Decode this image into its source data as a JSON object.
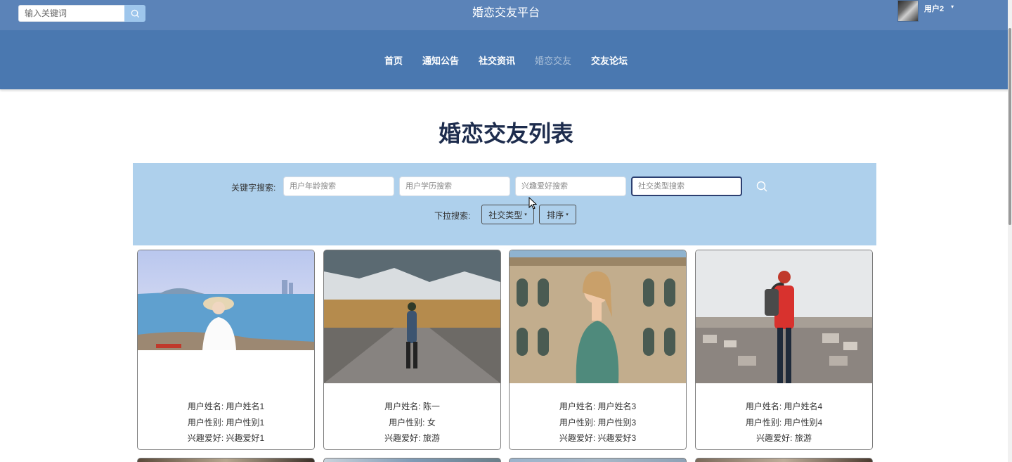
{
  "header": {
    "search_placeholder": "输入关键词",
    "site_title": "婚恋交友平台",
    "user_name": "用户2",
    "caret": "▾"
  },
  "nav": {
    "items": [
      {
        "label": "首页"
      },
      {
        "label": "通知公告"
      },
      {
        "label": "社交资讯"
      },
      {
        "label": "婚恋交友",
        "active": true
      },
      {
        "label": "交友论坛"
      }
    ]
  },
  "page": {
    "title": "婚恋交友列表"
  },
  "search_panel": {
    "keyword_label": "关键字搜索:",
    "inputs": [
      {
        "placeholder": "用户年龄搜索"
      },
      {
        "placeholder": "用户学历搜索"
      },
      {
        "placeholder": "兴趣爱好搜索"
      },
      {
        "placeholder": "社交类型搜索"
      }
    ],
    "dropdown_label": "下拉搜索:",
    "dropdowns": [
      {
        "label": "社交类型"
      },
      {
        "label": "排序"
      }
    ],
    "caret": "▾"
  },
  "cards": [
    {
      "name": "用户姓名: 用户姓名1",
      "gender": "用户性别: 用户性别1",
      "hobby": "兴趣爱好: 兴趣爱好1"
    },
    {
      "name": "用户姓名: 陈一",
      "gender": "用户性别: 女",
      "hobby": "兴趣爱好: 旅游"
    },
    {
      "name": "用户姓名: 用户姓名3",
      "gender": "用户性别: 用户性别3",
      "hobby": "兴趣爱好: 兴趣爱好3"
    },
    {
      "name": "用户姓名: 用户姓名4",
      "gender": "用户性别: 用户性别4",
      "hobby": "兴趣爱好: 旅游"
    }
  ],
  "colors": {
    "top_bar": "#5b83b8",
    "nav_bar": "#4a78b0",
    "panel": "#aed0ec",
    "title": "#1d2c4d"
  }
}
